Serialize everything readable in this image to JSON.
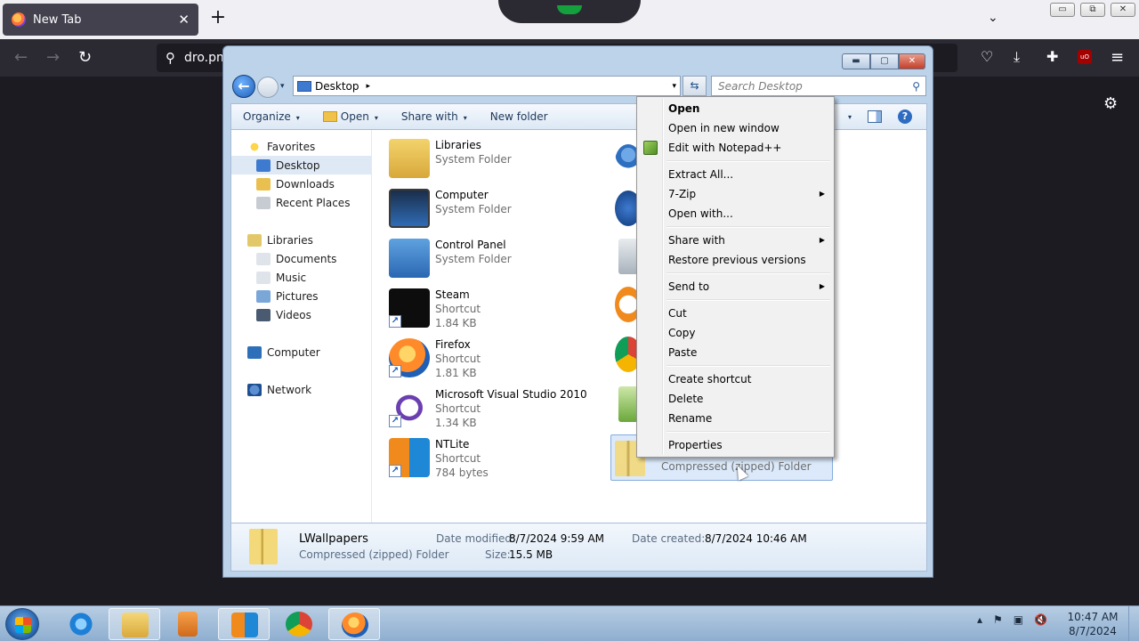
{
  "browser": {
    "tab_title": "New Tab",
    "tab_close": "✕",
    "new_tab": "+",
    "url_text": "dro.pm",
    "list_tabs": "⌄",
    "back": "←",
    "forward": "→",
    "reload": "↻",
    "search_icon": "⚲",
    "pocket": "♡",
    "downloads": "⤓",
    "extensions": "✚",
    "ublock_label": "uO",
    "menu": "≡",
    "settings": "⚙",
    "win_min": "▭",
    "win_restore": "⧉",
    "win_close": "✕"
  },
  "explorer": {
    "controls": {
      "min": "▬",
      "max": "▢",
      "close": "✕"
    },
    "address": {
      "location": "Desktop",
      "chevron": "▸",
      "dropdown": "▾"
    },
    "refresh": "⇆",
    "search_placeholder": "Search Desktop",
    "search_icon": "⚲",
    "toolbar": {
      "organize": "Organize",
      "open": "Open",
      "share_with": "Share with",
      "new_folder": "New folder",
      "arrow": "▾",
      "help": "?"
    },
    "nav": {
      "favorites": "Favorites",
      "desktop": "Desktop",
      "downloads": "Downloads",
      "recent_places": "Recent Places",
      "libraries": "Libraries",
      "documents": "Documents",
      "music": "Music",
      "pictures": "Pictures",
      "videos": "Videos",
      "computer": "Computer",
      "network": "Network"
    },
    "items": [
      {
        "name": "Libraries",
        "line2": "System Folder",
        "line3": ""
      },
      {
        "name": "Computer",
        "line2": "System Folder",
        "line3": ""
      },
      {
        "name": "Control Panel",
        "line2": "System Folder",
        "line3": ""
      },
      {
        "name": "Steam",
        "line2": "Shortcut",
        "line3": "1.84 KB"
      },
      {
        "name": "Firefox",
        "line2": "Shortcut",
        "line3": "1.81 KB"
      },
      {
        "name": "Microsoft Visual Studio 2010",
        "line2": "Shortcut",
        "line3": "1.34 KB"
      },
      {
        "name": "NTLite",
        "line2": "Shortcut",
        "line3": "784 bytes"
      }
    ],
    "shortcut_arrow": "↗",
    "selected_item_type": "Compressed (zipped) Folder",
    "details": {
      "name": "LWallpapers",
      "type": "Compressed (zipped) Folder",
      "date_modified_label": "Date modified:",
      "date_modified": "8/7/2024 9:59 AM",
      "size_label": "Size:",
      "size": "15.5 MB",
      "date_created_label": "Date created:",
      "date_created": "8/7/2024 10:46 AM"
    }
  },
  "context_menu": {
    "open": "Open",
    "open_new_window": "Open in new window",
    "edit_notepad": "Edit with Notepad++",
    "extract_all": "Extract All...",
    "seven_zip": "7-Zip",
    "open_with": "Open with...",
    "share_with": "Share with",
    "restore_versions": "Restore previous versions",
    "send_to": "Send to",
    "cut": "Cut",
    "copy": "Copy",
    "paste": "Paste",
    "create_shortcut": "Create shortcut",
    "delete": "Delete",
    "rename": "Rename",
    "properties": "Properties",
    "submenu_arrow": "▶"
  },
  "taskbar": {
    "tray_up": "▴",
    "tray_flag": "⚑",
    "tray_network": "▣",
    "tray_volume": "🔇",
    "time": "10:47 AM",
    "date": "8/7/2024"
  }
}
